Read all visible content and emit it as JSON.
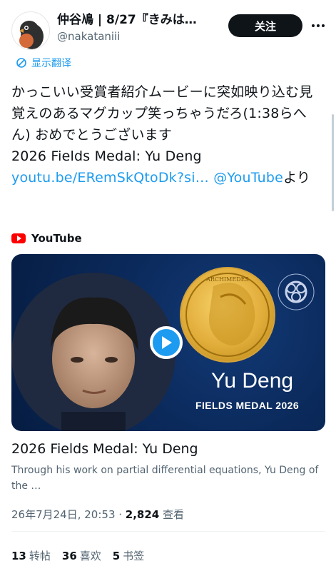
{
  "header": {
    "display_name": "仲谷鳰 | 8/27『きみは…",
    "handle": "@nakataniii",
    "follow_label": "关注",
    "more_icon": "more-horizontal-icon",
    "avatar_icon": "bird-avatar-icon"
  },
  "translate": {
    "label": "显示翻译",
    "icon": "translate-icon"
  },
  "tweet": {
    "body": "かっこいい受賞者紹介ムービーに突如映り込む見覚えのあるマグカップ笑っちゃうだろ(1:38らへん) おめでとうございます",
    "link_intro": "2026 Fields Medal: Yu Deng ",
    "url_text": "youtu.be/ERemSkQtoDk?si…",
    "mention": "@YouTube",
    "suffix": "より"
  },
  "card": {
    "source_label": "YouTube",
    "source_icon": "youtube-icon",
    "name": "Yu Deng",
    "subtitle": "FIELDS MEDAL 2026",
    "medal_text": "ARCHIMEDES",
    "play_icon": "play-icon",
    "title": "2026 Fields Medal: Yu Deng",
    "description": "Through his work on partial differential equations, Yu Deng of the …"
  },
  "meta": {
    "time": "26年7月24日, 20:53 · ",
    "views_count": "2,824",
    "views_label": " 查看"
  },
  "stats": {
    "retweets_count": "13",
    "retweets_label": "转帖",
    "likes_count": "36",
    "likes_label": "喜欢",
    "bookmarks_count": "5",
    "bookmarks_label": "书签"
  },
  "colors": {
    "accent": "#1d9bf0",
    "text": "#0f1419",
    "muted": "#536471",
    "youtube_red": "#ff0000",
    "card_bg": "#0b2a5c",
    "medal_gold": "#e2ae3c"
  }
}
